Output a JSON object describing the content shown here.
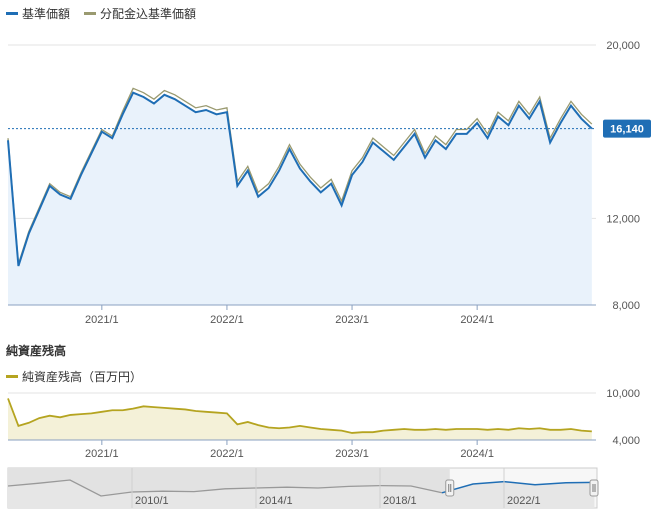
{
  "legend": {
    "nav": {
      "label": "基準価額",
      "color": "#1f6eb5"
    },
    "adjusted": {
      "label": "分配金込基準価額",
      "color": "#9a9a70"
    }
  },
  "aum_section": {
    "title": "純資産残高",
    "legend_label": "純資産残高（百万円）",
    "color": "#b5a420"
  },
  "chart_data": [
    {
      "type": "line",
      "title": "",
      "x_ticks": [
        "2021/1",
        "2022/1",
        "2023/1",
        "2024/1"
      ],
      "y_ticks": [
        "8,000",
        "12,000",
        "20,000"
      ],
      "ylim": [
        8000,
        20000
      ],
      "current_value": 16140,
      "current_label": "16,140",
      "series": [
        {
          "name": "基準価額",
          "x": [
            "2020/4",
            "2020/5",
            "2020/6",
            "2020/7",
            "2020/8",
            "2020/9",
            "2020/10",
            "2020/11",
            "2020/12",
            "2021/1",
            "2021/2",
            "2021/3",
            "2021/4",
            "2021/5",
            "2021/6",
            "2021/7",
            "2021/8",
            "2021/9",
            "2021/10",
            "2021/11",
            "2021/12",
            "2022/1",
            "2022/2",
            "2022/3",
            "2022/4",
            "2022/5",
            "2022/6",
            "2022/7",
            "2022/8",
            "2022/9",
            "2022/10",
            "2022/11",
            "2022/12",
            "2023/1",
            "2023/2",
            "2023/3",
            "2023/4",
            "2023/5",
            "2023/6",
            "2023/7",
            "2023/8",
            "2023/9",
            "2023/10",
            "2023/11",
            "2023/12",
            "2024/1",
            "2024/2",
            "2024/3",
            "2024/4",
            "2024/5",
            "2024/6",
            "2024/7",
            "2024/8",
            "2024/9",
            "2024/10",
            "2024/11",
            "2024/12"
          ],
          "values": [
            15600,
            9800,
            11300,
            12400,
            13500,
            13100,
            12900,
            14000,
            15000,
            16000,
            15700,
            16800,
            17800,
            17600,
            17300,
            17700,
            17500,
            17200,
            16900,
            17000,
            16800,
            16900,
            13500,
            14200,
            13000,
            13400,
            14200,
            15200,
            14300,
            13700,
            13200,
            13600,
            12600,
            14000,
            14600,
            15500,
            15100,
            14700,
            15300,
            15900,
            14800,
            15600,
            15200,
            15900,
            15900,
            16400,
            15700,
            16700,
            16300,
            17200,
            16600,
            17400,
            15500,
            16400,
            17200,
            16600,
            16140
          ]
        },
        {
          "name": "分配金込基準価額",
          "x": [
            "2020/4",
            "2020/5",
            "2020/6",
            "2020/7",
            "2020/8",
            "2020/9",
            "2020/10",
            "2020/11",
            "2020/12",
            "2021/1",
            "2021/2",
            "2021/3",
            "2021/4",
            "2021/5",
            "2021/6",
            "2021/7",
            "2021/8",
            "2021/9",
            "2021/10",
            "2021/11",
            "2021/12",
            "2022/1",
            "2022/2",
            "2022/3",
            "2022/4",
            "2022/5",
            "2022/6",
            "2022/7",
            "2022/8",
            "2022/9",
            "2022/10",
            "2022/11",
            "2022/12",
            "2023/1",
            "2023/2",
            "2023/3",
            "2023/4",
            "2023/5",
            "2023/6",
            "2023/7",
            "2023/8",
            "2023/9",
            "2023/10",
            "2023/11",
            "2023/12",
            "2024/1",
            "2024/2",
            "2024/3",
            "2024/4",
            "2024/5",
            "2024/6",
            "2024/7",
            "2024/8",
            "2024/9",
            "2024/10",
            "2024/11",
            "2024/12"
          ],
          "values": [
            15700,
            9900,
            11400,
            12500,
            13600,
            13200,
            13000,
            14100,
            15100,
            16100,
            15800,
            16950,
            18000,
            17800,
            17500,
            17900,
            17700,
            17400,
            17100,
            17200,
            17000,
            17100,
            13700,
            14400,
            13200,
            13600,
            14400,
            15400,
            14500,
            13900,
            13400,
            13800,
            12800,
            14200,
            14800,
            15700,
            15300,
            14900,
            15500,
            16100,
            15000,
            15800,
            15400,
            16100,
            16100,
            16600,
            15900,
            16900,
            16500,
            17400,
            16800,
            17600,
            15700,
            16600,
            17400,
            16800,
            16350
          ]
        }
      ]
    },
    {
      "type": "area",
      "title": "",
      "x_ticks": [
        "2021/1",
        "2022/1",
        "2023/1",
        "2024/1"
      ],
      "y_ticks": [
        "4,000",
        "10,000"
      ],
      "ylim": [
        4000,
        10000
      ],
      "series": [
        {
          "name": "純資産残高（百万円）",
          "x": [
            "2020/4",
            "2020/5",
            "2020/6",
            "2020/7",
            "2020/8",
            "2020/9",
            "2020/10",
            "2020/11",
            "2020/12",
            "2021/1",
            "2021/2",
            "2021/3",
            "2021/4",
            "2021/5",
            "2021/6",
            "2021/7",
            "2021/8",
            "2021/9",
            "2021/10",
            "2021/11",
            "2021/12",
            "2022/1",
            "2022/2",
            "2022/3",
            "2022/4",
            "2022/5",
            "2022/6",
            "2022/7",
            "2022/8",
            "2022/9",
            "2022/10",
            "2022/11",
            "2022/12",
            "2023/1",
            "2023/2",
            "2023/3",
            "2023/4",
            "2023/5",
            "2023/6",
            "2023/7",
            "2023/8",
            "2023/9",
            "2023/10",
            "2023/11",
            "2023/12",
            "2024/1",
            "2024/2",
            "2024/3",
            "2024/4",
            "2024/5",
            "2024/6",
            "2024/7",
            "2024/8",
            "2024/9",
            "2024/10",
            "2024/11",
            "2024/12"
          ],
          "values": [
            9300,
            5800,
            6200,
            6800,
            7100,
            6900,
            7200,
            7300,
            7400,
            7600,
            7800,
            7800,
            8000,
            8300,
            8200,
            8100,
            8000,
            7900,
            7700,
            7600,
            7500,
            7400,
            6000,
            6300,
            5900,
            5600,
            5500,
            5600,
            5800,
            5600,
            5400,
            5300,
            5200,
            4900,
            5000,
            5000,
            5200,
            5300,
            5400,
            5300,
            5300,
            5400,
            5300,
            5400,
            5400,
            5400,
            5300,
            5400,
            5300,
            5500,
            5400,
            5500,
            5300,
            5300,
            5400,
            5200,
            5100
          ]
        }
      ]
    },
    {
      "type": "area",
      "title": "",
      "x_ticks": [
        "2010/1",
        "2014/1",
        "2018/1",
        "2022/1"
      ],
      "series": [
        {
          "name": "",
          "x": [
            "2006/1",
            "2007/1",
            "2008/1",
            "2009/1",
            "2010/1",
            "2011/1",
            "2012/1",
            "2013/1",
            "2014/1",
            "2015/1",
            "2016/1",
            "2017/1",
            "2018/1",
            "2019/1",
            "2020/1",
            "2021/1",
            "2022/1",
            "2023/1",
            "2024/1",
            "2024/12"
          ],
          "values": [
            55,
            62,
            70,
            30,
            40,
            42,
            41,
            48,
            50,
            52,
            50,
            54,
            56,
            55,
            38,
            60,
            66,
            58,
            63,
            64
          ]
        }
      ]
    }
  ]
}
